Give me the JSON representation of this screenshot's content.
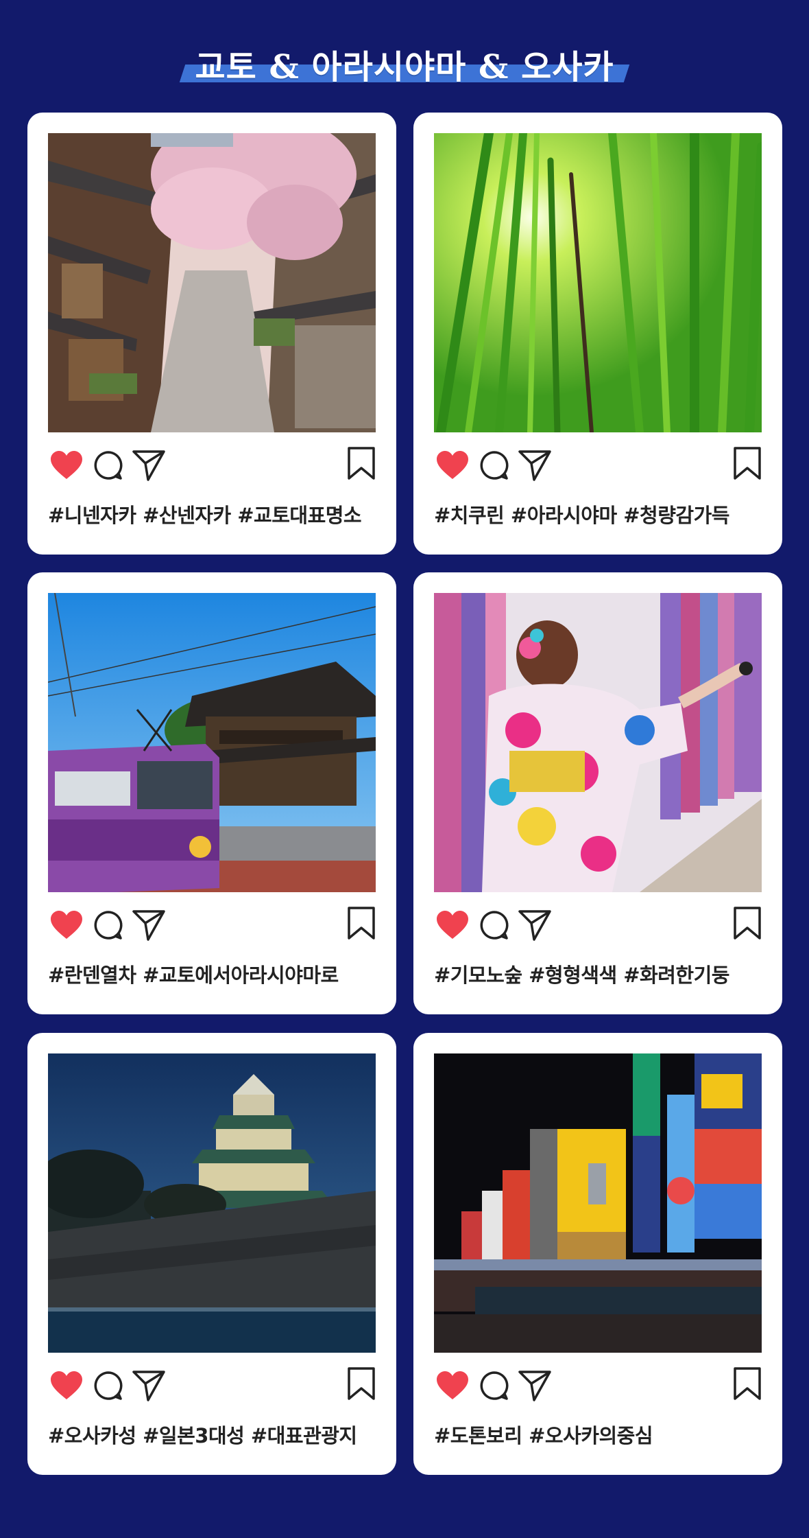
{
  "header": {
    "title": "교토 & 아라시야마 & 오사카"
  },
  "colors": {
    "background": "#121a6b",
    "title_bar": "#3d73d6",
    "card": "#ffffff",
    "heart": "#f0424f"
  },
  "posts": [
    {
      "photo_subject": "ninenzaka-street",
      "tags": "#니넨자카 #산넨자카 #교토대표명소"
    },
    {
      "photo_subject": "bamboo-forest",
      "tags": "#치쿠린 #아라시야마 #청량감가득"
    },
    {
      "photo_subject": "randen-train",
      "tags": "#란덴열차 #교토에서아라시야마로"
    },
    {
      "photo_subject": "kimono-forest",
      "tags": "#기모노숲 #형형색색 #화려한기둥"
    },
    {
      "photo_subject": "osaka-castle",
      "tags": "#오사카성 #일본3대성 #대표관광지"
    },
    {
      "photo_subject": "dotonbori",
      "tags": "#도톤보리 #오사카의중심"
    }
  ],
  "icons": [
    "heart-icon",
    "comment-icon",
    "share-icon",
    "bookmark-icon"
  ]
}
